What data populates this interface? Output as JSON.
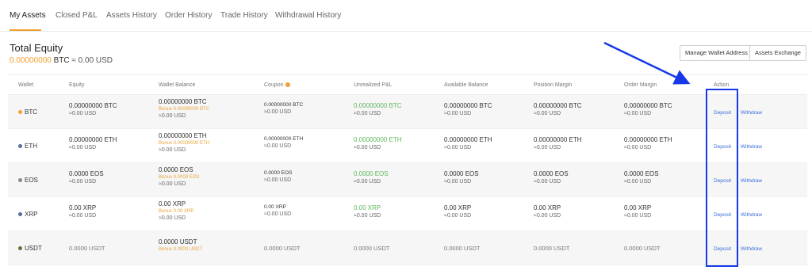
{
  "tabs": [
    "My Assets",
    "Closed P&L",
    "Assets History",
    "Order History",
    "Trade History",
    "Withdrawal History"
  ],
  "equity": {
    "title": "Total Equity",
    "btc_value": "0.00000000",
    "btc_unit": "BTC",
    "usd_text": "≈ 0.00 USD"
  },
  "buttons": {
    "manage_wallet": "Manage Wallet Address",
    "assets_exchange": "Assets Exchange"
  },
  "columns": [
    "Wallet",
    "Equity",
    "Wallet Balance",
    "Coupon",
    "Unrealized P&L",
    "Available Balance",
    "Position Margin",
    "Order Margin",
    "Action"
  ],
  "colors": {
    "accent": "#f0a12f",
    "link": "#3a6fd8",
    "positive": "#5fb75f",
    "annotation": "#1638e8"
  },
  "rows": [
    {
      "coin": "BTC",
      "dot_color": "#f0a12f",
      "equity": "0.00000000 BTC",
      "equity_usd": "≈0.00 USD",
      "wallet": "0.00000000 BTC",
      "bonus": "Bonus 0.00000000 BTC",
      "wallet_usd": "≈0.00 USD",
      "coupon": "0.00000000 BTC",
      "coupon_usd": "≈0.00 USD",
      "pnl": "0.00000000 BTC",
      "pnl_usd": "≈0.00 USD",
      "available": "0.00000000 BTC",
      "available_usd": "≈0.00 USD",
      "position": "0.00000000 BTC",
      "position_usd": "≈0.00 USD",
      "order": "0.00000000 BTC",
      "order_usd": "≈0.00 USD",
      "deposit": "Deposit",
      "withdraw": "Withdraw"
    },
    {
      "coin": "ETH",
      "dot_color": "#5b6b9b",
      "equity": "0.00000000 ETH",
      "equity_usd": "≈0.00 USD",
      "wallet": "0.00000000 ETH",
      "bonus": "Bonus 0.00000000 ETH",
      "wallet_usd": "≈0.00 USD",
      "coupon": "0.00000000 ETH",
      "coupon_usd": "≈0.00 USD",
      "pnl": "0.00000000 ETH",
      "pnl_usd": "≈0.00 USD",
      "available": "0.00000000 ETH",
      "available_usd": "≈0.00 USD",
      "position": "0.00000000 ETH",
      "position_usd": "≈0.00 USD",
      "order": "0.00000000 ETH",
      "order_usd": "≈0.00 USD",
      "deposit": "Deposit",
      "withdraw": "Withdraw"
    },
    {
      "coin": "EOS",
      "dot_color": "#8a8a8a",
      "equity": "0.0000 EOS",
      "equity_usd": "≈0.00 USD",
      "wallet": "0.0000 EOS",
      "bonus": "Bonus 0.0000 EOS",
      "wallet_usd": "≈0.00 USD",
      "coupon": "0.0000 EOS",
      "coupon_usd": "≈0.00 USD",
      "pnl": "0.0000 EOS",
      "pnl_usd": "≈0.00 USD",
      "available": "0.0000 EOS",
      "available_usd": "≈0.00 USD",
      "position": "0.0000 EOS",
      "position_usd": "≈0.00 USD",
      "order": "0.0000 EOS",
      "order_usd": "≈0.00 USD",
      "deposit": "Deposit",
      "withdraw": "Withdraw"
    },
    {
      "coin": "XRP",
      "dot_color": "#5b6b9b",
      "equity": "0.00 XRP",
      "equity_usd": "≈0.00 USD",
      "wallet": "0.00 XRP",
      "bonus": "Bonus 0.00 XRP",
      "wallet_usd": "≈0.00 USD",
      "coupon": "0.00 XRP",
      "coupon_usd": "≈0.00 USD",
      "pnl": "0.00 XRP",
      "pnl_usd": "≈0.00 USD",
      "available": "0.00 XRP",
      "available_usd": "≈0.00 USD",
      "position": "0.00 XRP",
      "position_usd": "≈0.00 USD",
      "order": "0.00 XRP",
      "order_usd": "≈0.00 USD",
      "deposit": "Deposit",
      "withdraw": "Withdraw"
    },
    {
      "coin": "USDT",
      "dot_color": "#6b6b3a",
      "equity": "0.0000 USDT",
      "wallet": "0.0000 USDT",
      "bonus": "Bonus 0.0000 USDT",
      "coupon": "0.0000 USDT",
      "pnl": "0.0000 USDT",
      "available": "0.0000 USDT",
      "position": "0.0000 USDT",
      "order": "0.0000 USDT",
      "deposit": "Deposit",
      "withdraw": "Withdraw"
    }
  ]
}
